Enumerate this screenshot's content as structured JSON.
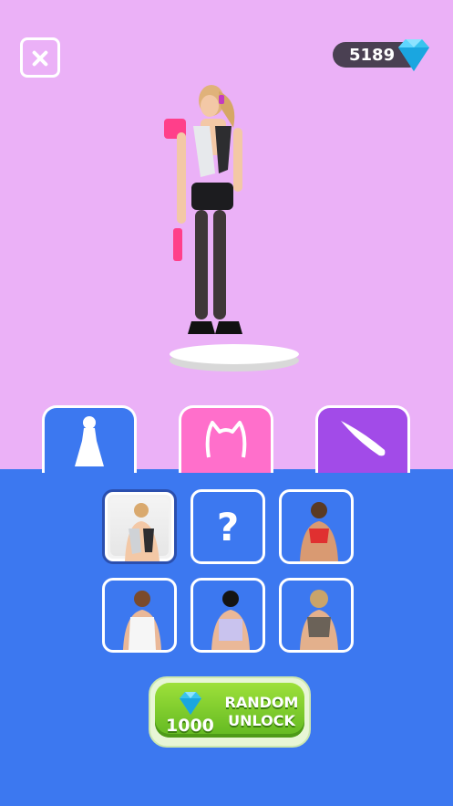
{
  "currency": {
    "gems": "5189"
  },
  "tabs": [
    {
      "name": "outfit",
      "icon": "dress-icon",
      "color": "#3c78f0"
    },
    {
      "name": "accessory",
      "icon": "cat-ears-headband-icon",
      "color": "#ff6fcb"
    },
    {
      "name": "hair",
      "icon": "hair-lock-icon",
      "color": "#a24be8"
    }
  ],
  "items": [
    {
      "id": "outfit-1",
      "state": "selected"
    },
    {
      "id": "outfit-2",
      "state": "locked",
      "label": "?"
    },
    {
      "id": "outfit-3",
      "state": "unlocked"
    },
    {
      "id": "outfit-4",
      "state": "unlocked"
    },
    {
      "id": "outfit-5",
      "state": "unlocked"
    },
    {
      "id": "outfit-6",
      "state": "unlocked"
    }
  ],
  "random_unlock": {
    "line1": "RANDOM",
    "line2": "UNLOCK",
    "price": "1000"
  },
  "colors": {
    "stage_bg": "#ebb1f7",
    "panel_bg": "#3c78f0",
    "button_green": "#7fd02c"
  }
}
